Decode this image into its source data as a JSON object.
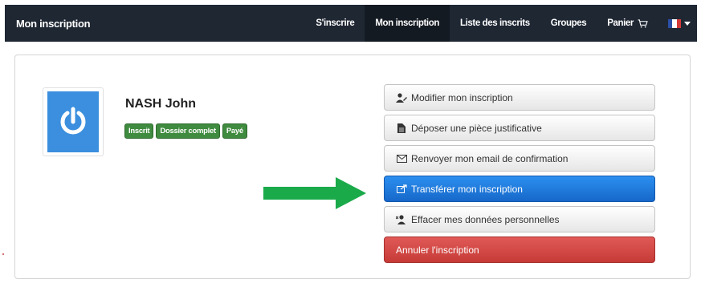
{
  "navbar": {
    "brand": "Mon inscription",
    "links": [
      {
        "label": "S'inscrire",
        "active": false
      },
      {
        "label": "Mon inscription",
        "active": true
      },
      {
        "label": "Liste des inscrits",
        "active": false
      },
      {
        "label": "Groupes",
        "active": false
      },
      {
        "label": "Panier",
        "active": false
      }
    ],
    "cart_icon": "cart-icon",
    "language_flag": "french-flag-icon",
    "colors": {
      "background": "#1f2733",
      "active": "#141a22"
    }
  },
  "profile": {
    "name": "NASH John",
    "avatar_icon": "power-icon",
    "avatar_color": "#3b8fde",
    "badges": [
      "Inscrit",
      "Dossier complet",
      "Payé"
    ],
    "badge_color": "#3f8b3f"
  },
  "actions": [
    {
      "label": "Modifier mon inscription",
      "icon": "user-edit-icon",
      "style": "default"
    },
    {
      "label": "Déposer une pièce justificative",
      "icon": "document-icon",
      "style": "default"
    },
    {
      "label": "Renvoyer mon email de confirmation",
      "icon": "envelope-icon",
      "style": "default"
    },
    {
      "label": "Transférer mon inscription",
      "icon": "share-icon",
      "style": "primary"
    },
    {
      "label": "Effacer mes données personnelles",
      "icon": "user-remove-icon",
      "style": "default"
    },
    {
      "label": "Annuler l'inscription",
      "icon": "",
      "style": "danger"
    }
  ],
  "annotation": {
    "arrow_icon": "green-arrow-icon",
    "color": "#1aaa4a"
  }
}
